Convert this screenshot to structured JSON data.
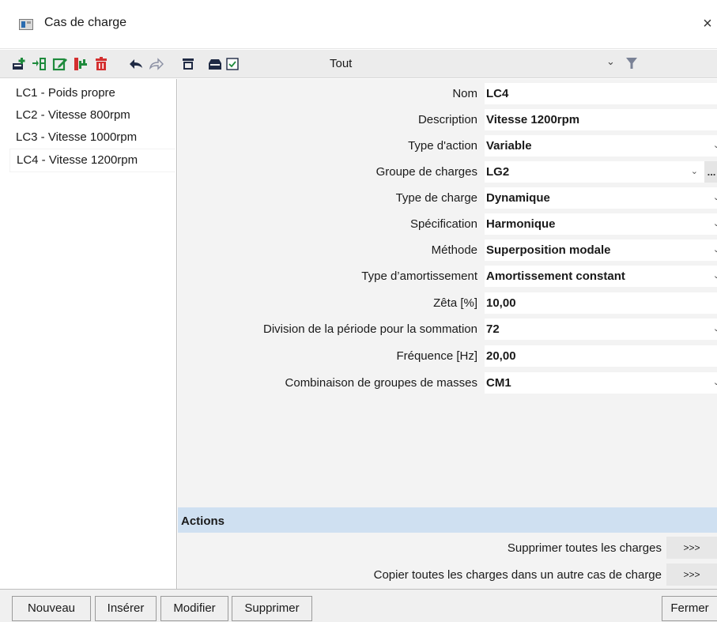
{
  "window": {
    "title": "Cas de charge",
    "close_glyph": "×"
  },
  "toolbar": {
    "icons": [
      "new-icon",
      "insert-icon",
      "edit-icon",
      "copy-icon",
      "delete-icon",
      "undo-icon",
      "redo-icon",
      "print-icon",
      "save-icon",
      "checkbox-icon"
    ],
    "filter_value": "Tout",
    "filter_chevron": "⌄"
  },
  "load_cases": [
    {
      "label": "LC1 - Poids propre"
    },
    {
      "label": "LC2 - Vitesse 800rpm"
    },
    {
      "label": "LC3 - Vitesse 1000rpm"
    },
    {
      "label": "LC4 - Vitesse 1200rpm",
      "selected": true
    }
  ],
  "properties": [
    {
      "label": "Nom",
      "value": "LC4",
      "dropdown": false
    },
    {
      "label": "Description",
      "value": "Vitesse 1200rpm",
      "dropdown": false
    },
    {
      "label": "Type d'action",
      "value": "Variable",
      "dropdown": true
    },
    {
      "label": "Groupe de charges",
      "value": "LG2",
      "dropdown": true,
      "more": "..."
    },
    {
      "label": "Type de charge",
      "value": "Dynamique",
      "dropdown": true
    },
    {
      "label": "Spécification",
      "value": "Harmonique",
      "dropdown": true
    },
    {
      "label": "Méthode",
      "value": "Superposition modale",
      "dropdown": true
    },
    {
      "label": "Type d’amortissement",
      "value": "Amortissement constant",
      "dropdown": true
    },
    {
      "label": "Zêta [%]",
      "value": "10,00",
      "dropdown": false
    },
    {
      "label": "Division de la période pour la sommation",
      "value": "72",
      "dropdown": true
    },
    {
      "label": "Fréquence [Hz]",
      "value": "20,00",
      "dropdown": false
    },
    {
      "label": "Combinaison de groupes de masses",
      "value": "CM1",
      "dropdown": true
    }
  ],
  "actions": {
    "header": "Actions",
    "items": [
      {
        "label": "Supprimer toutes les charges",
        "button": ">>>"
      },
      {
        "label": "Copier toutes les charges dans un autre cas de charge",
        "button": ">>>"
      }
    ]
  },
  "bottom_buttons": {
    "new": "Nouveau",
    "insert": "Insérer",
    "modify": "Modifier",
    "delete": "Supprimer",
    "close": "Fermer"
  },
  "colors": {
    "actions_header": "#cfe0f1",
    "toolbar_green": "#1e8a3c",
    "toolbar_red": "#d32f2f",
    "toolbar_navy": "#1f2a44"
  }
}
